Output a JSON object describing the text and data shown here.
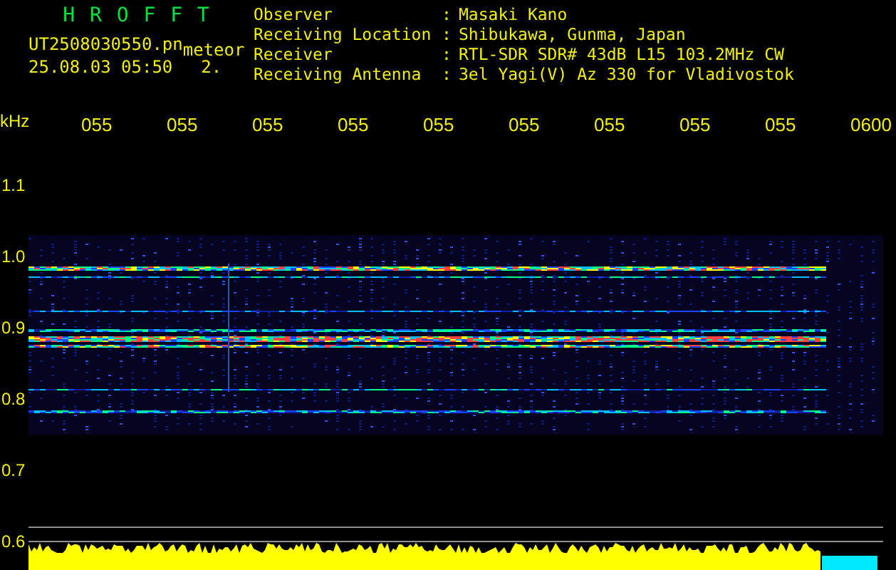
{
  "header": {
    "app_title": "H R O F F T",
    "file_name": "UT2508030550.pn",
    "mode": "meteor",
    "date_time": "25.08.03 05:50",
    "value": "2."
  },
  "station_info": [
    {
      "label": "Observer",
      "separator": ":",
      "value": "Masaki Kano"
    },
    {
      "label": "Receiving Location",
      "separator": ":",
      "value": "Shibukawa, Gunma, Japan"
    },
    {
      "label": "Receiver",
      "separator": ":",
      "value": "RTL-SDR SDR# 43dB L15 103.2MHz CW"
    },
    {
      "label": "Receiving Antenna",
      "separator": ":",
      "value": "3el Yagi(V) Az 330 for Vladivostok"
    }
  ],
  "plot": {
    "unit": "kHz",
    "time_labels": [
      "055",
      "055",
      "055",
      "055",
      "055",
      "055",
      "055",
      "055",
      "055",
      "0600"
    ],
    "freq_labels": [
      "1.1",
      "1.0",
      "0.9",
      "0.8",
      "0.7",
      "0.6"
    ]
  }
}
